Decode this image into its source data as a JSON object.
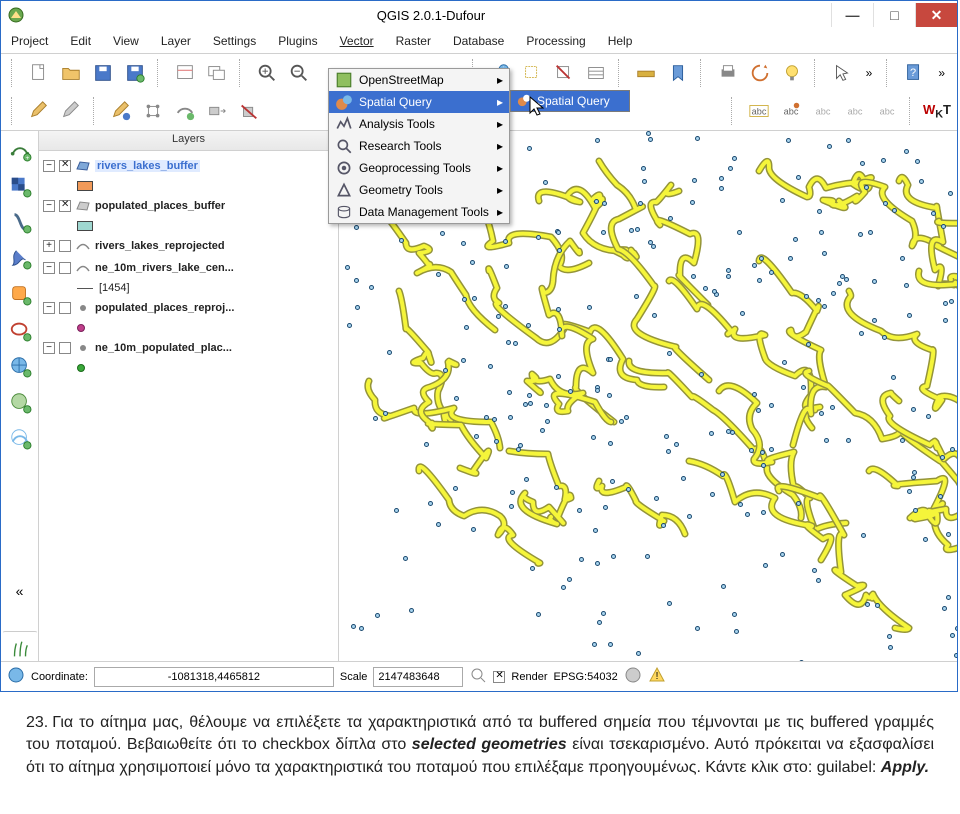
{
  "window": {
    "title": "QGIS 2.0.1-Dufour",
    "min": "—",
    "max": "□",
    "close": "✕"
  },
  "menu": {
    "project": "Project",
    "edit": "Edit",
    "view": "View",
    "layer": "Layer",
    "settings": "Settings",
    "plugins": "Plugins",
    "vector": "Vector",
    "raster": "Raster",
    "database": "Database",
    "processing": "Processing",
    "help": "Help"
  },
  "vector_menu": {
    "items": [
      {
        "label": "OpenStreetMap"
      },
      {
        "label": "Spatial Query"
      },
      {
        "label": "Analysis Tools"
      },
      {
        "label": "Research Tools"
      },
      {
        "label": "Geoprocessing Tools"
      },
      {
        "label": "Geometry Tools"
      },
      {
        "label": "Data Management Tools"
      }
    ],
    "submenu_label": "Spatial Query"
  },
  "panels": {
    "layers_title": "Layers",
    "layers": [
      {
        "name": "rivers_lakes_buffer",
        "selected": true,
        "swatch": "#f19a59"
      },
      {
        "name": "populated_places_buffer",
        "swatch": "#9fd7d0"
      },
      {
        "name": "rivers_lakes_reprojected"
      },
      {
        "name": "ne_10m_rivers_lake_cen...",
        "child_label": "[1454]"
      },
      {
        "name": "populated_places_reproj...",
        "dot": "#c03f8a"
      },
      {
        "name": "ne_10m_populated_plac...",
        "dot": "#3aa83a"
      }
    ]
  },
  "status": {
    "coord_label": "Coordinate:",
    "coord_value": "-1081318,4465812",
    "scale_label": "Scale",
    "scale_value": "2147483648",
    "render_label": "Render",
    "epsg": "EPSG:54032"
  },
  "overflow": "»",
  "caption": {
    "num": "23.",
    "text_part1": "Για το αίτημα μας, θέλουμε να επιλέξετε τα χαρακτηριστικά από τα buffered σημεία που τέμνονται με τις buffered γραμμές του ποταμού. Βεβαιωθείτε ότι το checkbox δίπλα στο ",
    "emph": "selected geometries",
    "text_part2": " είναι τσεκαρισμένο. Αυτό πρόκειται να εξασφαλίσει ότι το αίτημα χρησιμοποιεί μόνο τα χαρακτηριστικά του ποταμού που επιλέξαμε προηγουμένως. Κάντε κλικ στο: guilabel: ",
    "apply": "Apply."
  }
}
